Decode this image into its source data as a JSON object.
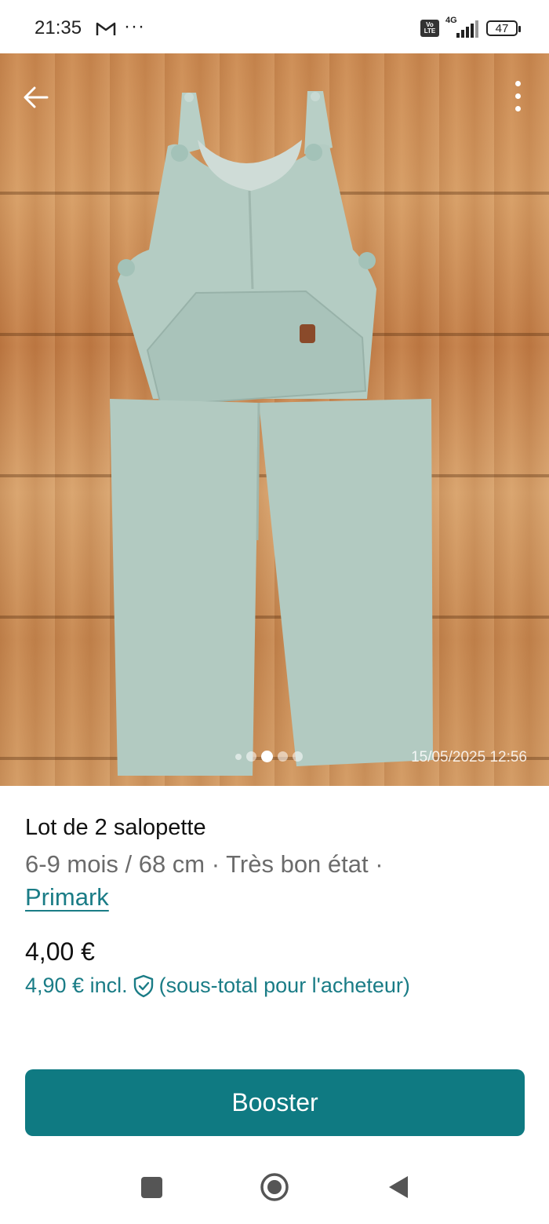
{
  "status_bar": {
    "time": "21:35",
    "notification_icons": [
      "gmail-icon",
      "more-dots-icon"
    ],
    "dots": "···",
    "volte": "Vo LTE",
    "network": "4G",
    "battery": "47"
  },
  "photo": {
    "timestamp": "15/05/2025 12:56",
    "indicator_count": 5,
    "active_index": 2
  },
  "listing": {
    "title": "Lot de 2 salopette",
    "details": "6-9 mois / 68 cm · Très bon état · ",
    "brand": "Primark",
    "price": "4,00 €",
    "price_incl_amount": "4,90 € incl.",
    "price_incl_note": "(sous-total pour l'acheteur)"
  },
  "actions": {
    "booster_label": "Booster"
  },
  "colors": {
    "accent": "#0f7a82",
    "link": "#1a7c86"
  }
}
